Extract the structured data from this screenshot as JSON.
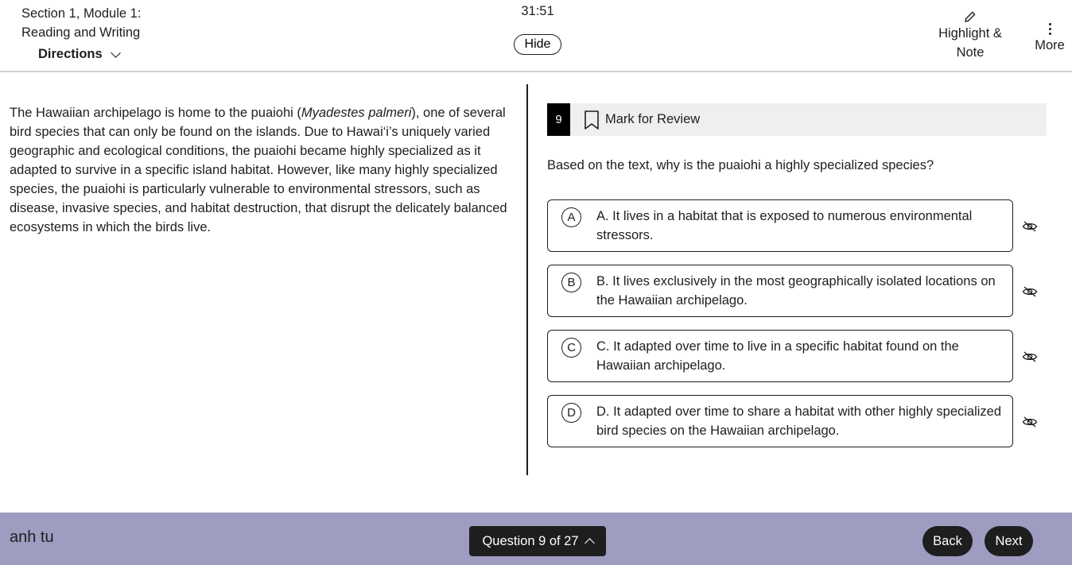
{
  "header": {
    "section_line1": "Section 1, Module 1:",
    "section_line2": "Reading and Writing",
    "directions_label": "Directions",
    "timer": "31:51",
    "hide_label": "Hide",
    "highlight_line1": "Highlight &",
    "highlight_line2": "Note",
    "more_label": "More"
  },
  "passage": {
    "before_italic": "The Hawaiian archipelago is home to the puaiohi (",
    "italic": "Myadestes palmeri",
    "after_italic": "), one of several bird species that can only be found on the islands. Due to Hawai‘i’s uniquely varied geographic and ecological conditions, the puaiohi became highly specialized as it adapted to survive in a specific island habitat. However, like many highly specialized species, the puaiohi is particularly vulnerable to environmental stressors, such as disease, invasive species, and habitat destruction, that disrupt the delicately balanced ecosystems in which the birds live."
  },
  "question": {
    "number": "9",
    "mark_label": "Mark for Review",
    "prompt": "Based on the text, why is the puaiohi a highly specialized species?",
    "options": [
      {
        "letter": "A",
        "text": "A. It lives in a habitat that is exposed to numerous environmental stressors."
      },
      {
        "letter": "B",
        "text": "B. It lives exclusively in the most geographically isolated locations on the Hawaiian archipelago."
      },
      {
        "letter": "C",
        "text": "C. It adapted over time to live in a specific habitat found on the Hawaiian archipelago."
      },
      {
        "letter": "D",
        "text": "D. It adapted over time to share a habitat with other highly specialized bird species on the Hawaiian archipelago."
      }
    ]
  },
  "footer": {
    "user_name": "anh tu",
    "question_nav": "Question 9 of 27",
    "back_label": "Back",
    "next_label": "Next"
  },
  "icons": {
    "directions": "chevron-down-icon",
    "highlight": "pencil-icon",
    "more": "vertical-dots-icon",
    "mark": "bookmark-icon",
    "eliminate": "eye-slash-icon",
    "question_nav": "chevron-up-icon"
  },
  "colors": {
    "footer_bg": "#9e9cc0",
    "question_badge": "#000000",
    "mark_bar_bg": "#efefef",
    "button_bg": "#1e1e1e"
  }
}
